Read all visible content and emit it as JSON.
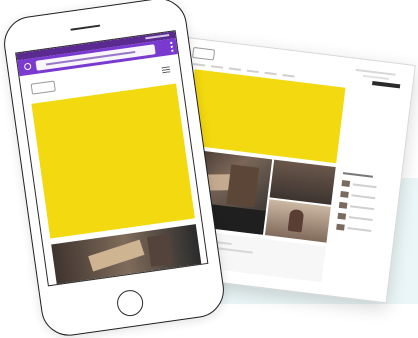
{
  "scene": {
    "background_color": "#ffffff",
    "wash_color": "#eaf6f7"
  },
  "desktop_mockup": {
    "accent_color": "#f3d90f",
    "header_bar_color": "#2b2b2b"
  },
  "phone_mockup": {
    "browser_color": "#7a3ad0",
    "status_bar_color": "#5a2a91",
    "accent_color": "#f3d90f"
  }
}
